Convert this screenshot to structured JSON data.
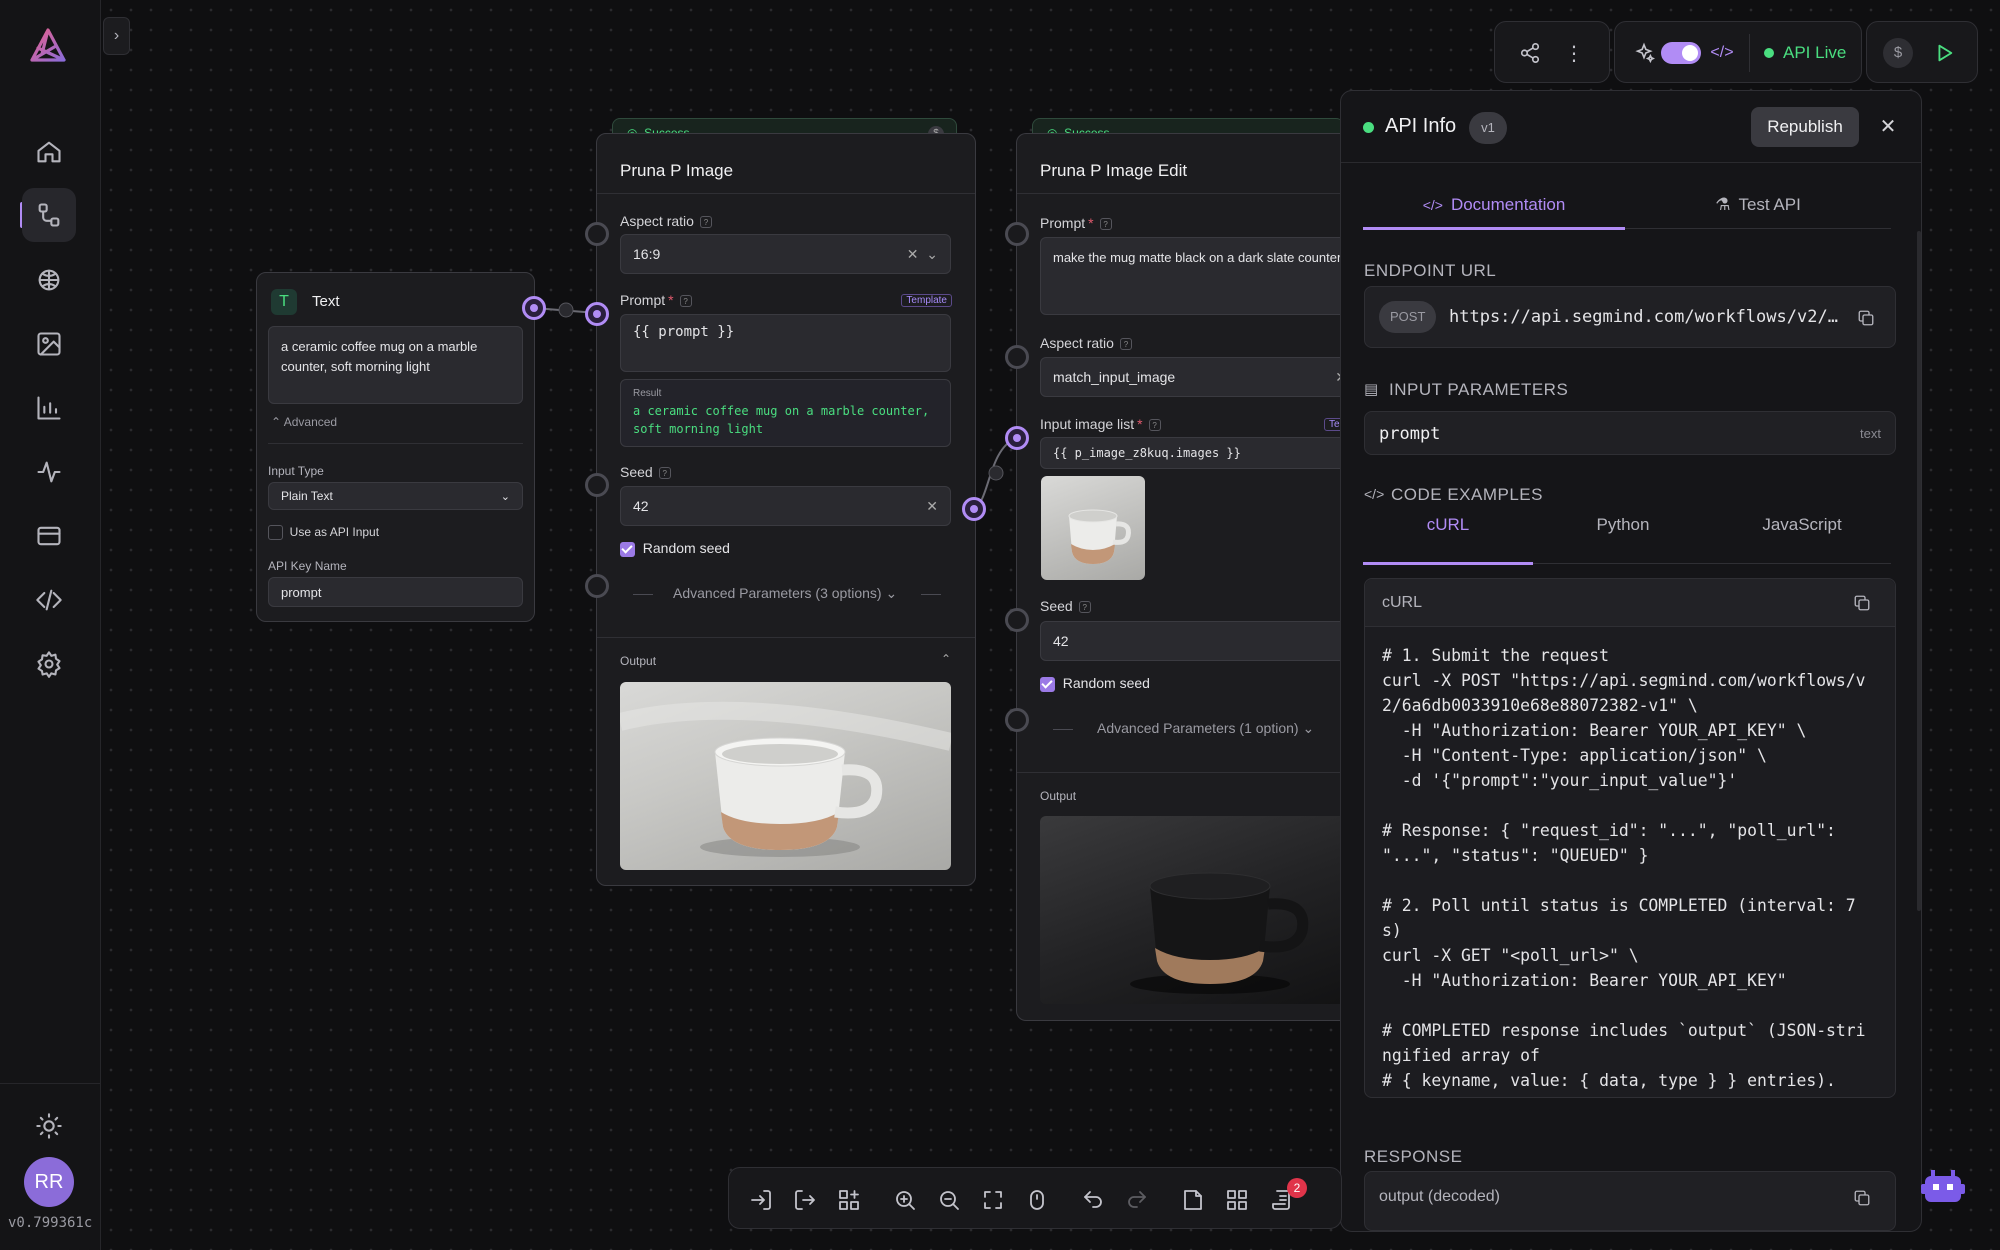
{
  "app": {
    "version": "v0.799361c",
    "user_initials": "RR"
  },
  "text_node": {
    "title": "Text",
    "value": "a ceramic coffee mug on a marble counter, soft morning light",
    "advanced_label": "Advanced",
    "input_type_label": "Input Type",
    "input_type_value": "Plain Text",
    "use_api_label": "Use as API Input",
    "api_key_label": "API Key Name",
    "api_key_value": "prompt"
  },
  "image_node": {
    "status": "Success",
    "title": "Pruna P Image",
    "aspect_label": "Aspect ratio",
    "aspect_value": "16:9",
    "prompt_label": "Prompt",
    "template_badge": "Template",
    "prompt_value": "{{ prompt }}",
    "result_label": "Result",
    "result_value": "a ceramic coffee mug on a marble counter, soft morning light",
    "seed_label": "Seed",
    "seed_value": "42",
    "random_seed_label": "Random seed",
    "advanced_label": "Advanced Parameters (3 options)",
    "output_label": "Output"
  },
  "edit_node": {
    "status": "Success",
    "title": "Pruna P Image Edit",
    "prompt_label": "Prompt",
    "prompt_value": "make the mug matte black on a dark slate counter",
    "aspect_label": "Aspect ratio",
    "aspect_value": "match_input_image",
    "image_list_label": "Input image list",
    "image_list_badge": "Te",
    "image_list_value": "{{ p_image_z8kuq.images }}",
    "seed_label": "Seed",
    "seed_value": "42",
    "random_seed_label": "Random seed",
    "advanced_label": "Advanced Parameters (1 option)",
    "output_label": "Output"
  },
  "top_toolbar": {
    "api_status": "API Live"
  },
  "api_panel": {
    "title": "API Info",
    "version_badge": "v1",
    "republish_label": "Republish",
    "tabs": [
      {
        "label": "Documentation"
      },
      {
        "label": "Test API"
      }
    ],
    "endpoint_section": "ENDPOINT URL",
    "method": "POST",
    "endpoint_url": "https://api.segmind.com/workflows/v2/…",
    "input_section": "INPUT PARAMETERS",
    "param_name": "prompt",
    "param_type": "text",
    "code_section": "CODE EXAMPLES",
    "code_tabs": [
      {
        "label": "cURL"
      },
      {
        "label": "Python"
      },
      {
        "label": "JavaScript"
      }
    ],
    "code_header": "cURL",
    "code_lines": [
      "# 1. Submit the request",
      "curl -X POST \"https://api.segmind.com/workflows/v",
      "2/6a6db0033910e68e88072382-v1\" \\",
      "  -H \"Authorization: Bearer YOUR_API_KEY\" \\",
      "  -H \"Content-Type: application/json\" \\",
      "  -d '{\"prompt\":\"your_input_value\"}'",
      "",
      "# Response: { \"request_id\": \"...\", \"poll_url\":",
      "\"...\", \"status\": \"QUEUED\" }",
      "",
      "# 2. Poll until status is COMPLETED (interval: 7",
      "s)",
      "curl -X GET \"<poll_url>\" \\",
      "  -H \"Authorization: Bearer YOUR_API_KEY\"",
      "",
      "# COMPLETED response includes `output` (JSON-stri",
      "ngified array of",
      "# { keyname, value: { data, type } } entries)."
    ],
    "response_section": "RESPONSE",
    "response_header": "output (decoded)"
  },
  "bottom_bar": {
    "notification_count": "2"
  },
  "colors": {
    "accent": "#b18cf5",
    "success": "#4ade80",
    "background": "#0f0f11",
    "panel": "#151518"
  }
}
